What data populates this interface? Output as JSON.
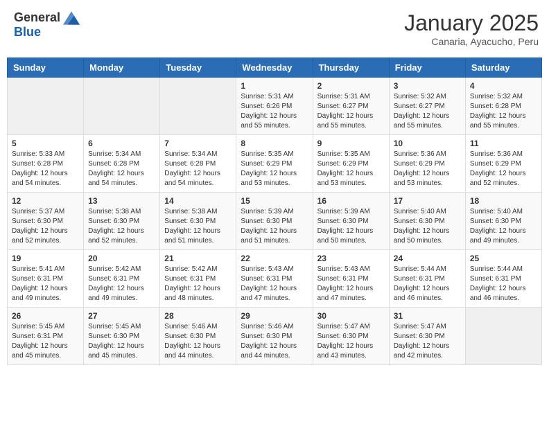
{
  "header": {
    "logo_general": "General",
    "logo_blue": "Blue",
    "month": "January 2025",
    "location": "Canaria, Ayacucho, Peru"
  },
  "days_of_week": [
    "Sunday",
    "Monday",
    "Tuesday",
    "Wednesday",
    "Thursday",
    "Friday",
    "Saturday"
  ],
  "weeks": [
    [
      {
        "day": "",
        "content": ""
      },
      {
        "day": "",
        "content": ""
      },
      {
        "day": "",
        "content": ""
      },
      {
        "day": "1",
        "content": "Sunrise: 5:31 AM\nSunset: 6:26 PM\nDaylight: 12 hours\nand 55 minutes."
      },
      {
        "day": "2",
        "content": "Sunrise: 5:31 AM\nSunset: 6:27 PM\nDaylight: 12 hours\nand 55 minutes."
      },
      {
        "day": "3",
        "content": "Sunrise: 5:32 AM\nSunset: 6:27 PM\nDaylight: 12 hours\nand 55 minutes."
      },
      {
        "day": "4",
        "content": "Sunrise: 5:32 AM\nSunset: 6:28 PM\nDaylight: 12 hours\nand 55 minutes."
      }
    ],
    [
      {
        "day": "5",
        "content": "Sunrise: 5:33 AM\nSunset: 6:28 PM\nDaylight: 12 hours\nand 54 minutes."
      },
      {
        "day": "6",
        "content": "Sunrise: 5:34 AM\nSunset: 6:28 PM\nDaylight: 12 hours\nand 54 minutes."
      },
      {
        "day": "7",
        "content": "Sunrise: 5:34 AM\nSunset: 6:28 PM\nDaylight: 12 hours\nand 54 minutes."
      },
      {
        "day": "8",
        "content": "Sunrise: 5:35 AM\nSunset: 6:29 PM\nDaylight: 12 hours\nand 53 minutes."
      },
      {
        "day": "9",
        "content": "Sunrise: 5:35 AM\nSunset: 6:29 PM\nDaylight: 12 hours\nand 53 minutes."
      },
      {
        "day": "10",
        "content": "Sunrise: 5:36 AM\nSunset: 6:29 PM\nDaylight: 12 hours\nand 53 minutes."
      },
      {
        "day": "11",
        "content": "Sunrise: 5:36 AM\nSunset: 6:29 PM\nDaylight: 12 hours\nand 52 minutes."
      }
    ],
    [
      {
        "day": "12",
        "content": "Sunrise: 5:37 AM\nSunset: 6:30 PM\nDaylight: 12 hours\nand 52 minutes."
      },
      {
        "day": "13",
        "content": "Sunrise: 5:38 AM\nSunset: 6:30 PM\nDaylight: 12 hours\nand 52 minutes."
      },
      {
        "day": "14",
        "content": "Sunrise: 5:38 AM\nSunset: 6:30 PM\nDaylight: 12 hours\nand 51 minutes."
      },
      {
        "day": "15",
        "content": "Sunrise: 5:39 AM\nSunset: 6:30 PM\nDaylight: 12 hours\nand 51 minutes."
      },
      {
        "day": "16",
        "content": "Sunrise: 5:39 AM\nSunset: 6:30 PM\nDaylight: 12 hours\nand 50 minutes."
      },
      {
        "day": "17",
        "content": "Sunrise: 5:40 AM\nSunset: 6:30 PM\nDaylight: 12 hours\nand 50 minutes."
      },
      {
        "day": "18",
        "content": "Sunrise: 5:40 AM\nSunset: 6:30 PM\nDaylight: 12 hours\nand 49 minutes."
      }
    ],
    [
      {
        "day": "19",
        "content": "Sunrise: 5:41 AM\nSunset: 6:31 PM\nDaylight: 12 hours\nand 49 minutes."
      },
      {
        "day": "20",
        "content": "Sunrise: 5:42 AM\nSunset: 6:31 PM\nDaylight: 12 hours\nand 49 minutes."
      },
      {
        "day": "21",
        "content": "Sunrise: 5:42 AM\nSunset: 6:31 PM\nDaylight: 12 hours\nand 48 minutes."
      },
      {
        "day": "22",
        "content": "Sunrise: 5:43 AM\nSunset: 6:31 PM\nDaylight: 12 hours\nand 47 minutes."
      },
      {
        "day": "23",
        "content": "Sunrise: 5:43 AM\nSunset: 6:31 PM\nDaylight: 12 hours\nand 47 minutes."
      },
      {
        "day": "24",
        "content": "Sunrise: 5:44 AM\nSunset: 6:31 PM\nDaylight: 12 hours\nand 46 minutes."
      },
      {
        "day": "25",
        "content": "Sunrise: 5:44 AM\nSunset: 6:31 PM\nDaylight: 12 hours\nand 46 minutes."
      }
    ],
    [
      {
        "day": "26",
        "content": "Sunrise: 5:45 AM\nSunset: 6:31 PM\nDaylight: 12 hours\nand 45 minutes."
      },
      {
        "day": "27",
        "content": "Sunrise: 5:45 AM\nSunset: 6:30 PM\nDaylight: 12 hours\nand 45 minutes."
      },
      {
        "day": "28",
        "content": "Sunrise: 5:46 AM\nSunset: 6:30 PM\nDaylight: 12 hours\nand 44 minutes."
      },
      {
        "day": "29",
        "content": "Sunrise: 5:46 AM\nSunset: 6:30 PM\nDaylight: 12 hours\nand 44 minutes."
      },
      {
        "day": "30",
        "content": "Sunrise: 5:47 AM\nSunset: 6:30 PM\nDaylight: 12 hours\nand 43 minutes."
      },
      {
        "day": "31",
        "content": "Sunrise: 5:47 AM\nSunset: 6:30 PM\nDaylight: 12 hours\nand 42 minutes."
      },
      {
        "day": "",
        "content": ""
      }
    ]
  ]
}
